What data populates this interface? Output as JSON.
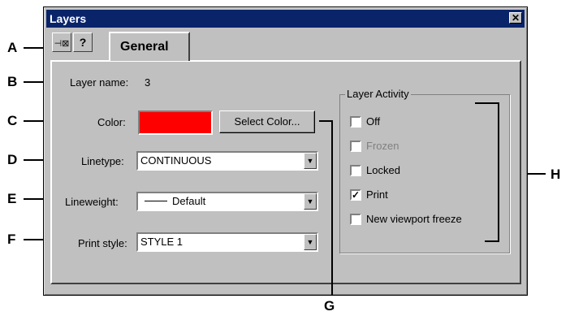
{
  "window": {
    "title": "Layers",
    "close_glyph": "✕"
  },
  "toolbar": {
    "pin_glyph": "⊣⊠",
    "help_glyph": "?"
  },
  "tabs": [
    {
      "label": "General"
    }
  ],
  "fields": {
    "layer_name_label": "Layer name:",
    "layer_name_value": "3",
    "color_label": "Color:",
    "color_value_hex": "#ff0000",
    "select_color_button": "Select Color...",
    "linetype_label": "Linetype:",
    "linetype_value": "CONTINUOUS",
    "lineweight_label": "Lineweight:",
    "lineweight_value": "Default",
    "print_style_label": "Print style:",
    "print_style_value": "STYLE 1"
  },
  "activity": {
    "title": "Layer Activity",
    "items": [
      {
        "label": "Off",
        "checked": false,
        "disabled": false
      },
      {
        "label": "Frozen",
        "checked": false,
        "disabled": true
      },
      {
        "label": "Locked",
        "checked": false,
        "disabled": false
      },
      {
        "label": "Print",
        "checked": true,
        "disabled": false
      },
      {
        "label": "New viewport freeze",
        "checked": false,
        "disabled": false
      }
    ]
  },
  "callouts": {
    "a": "A",
    "b": "B",
    "c": "C",
    "d": "D",
    "e": "E",
    "f": "F",
    "g": "G",
    "h": "H"
  },
  "colors": {
    "title_bar": "#0a246a",
    "dialog": "#c0c0c0",
    "color_swatch": "#ff0000",
    "disabled_text": "#808080"
  }
}
